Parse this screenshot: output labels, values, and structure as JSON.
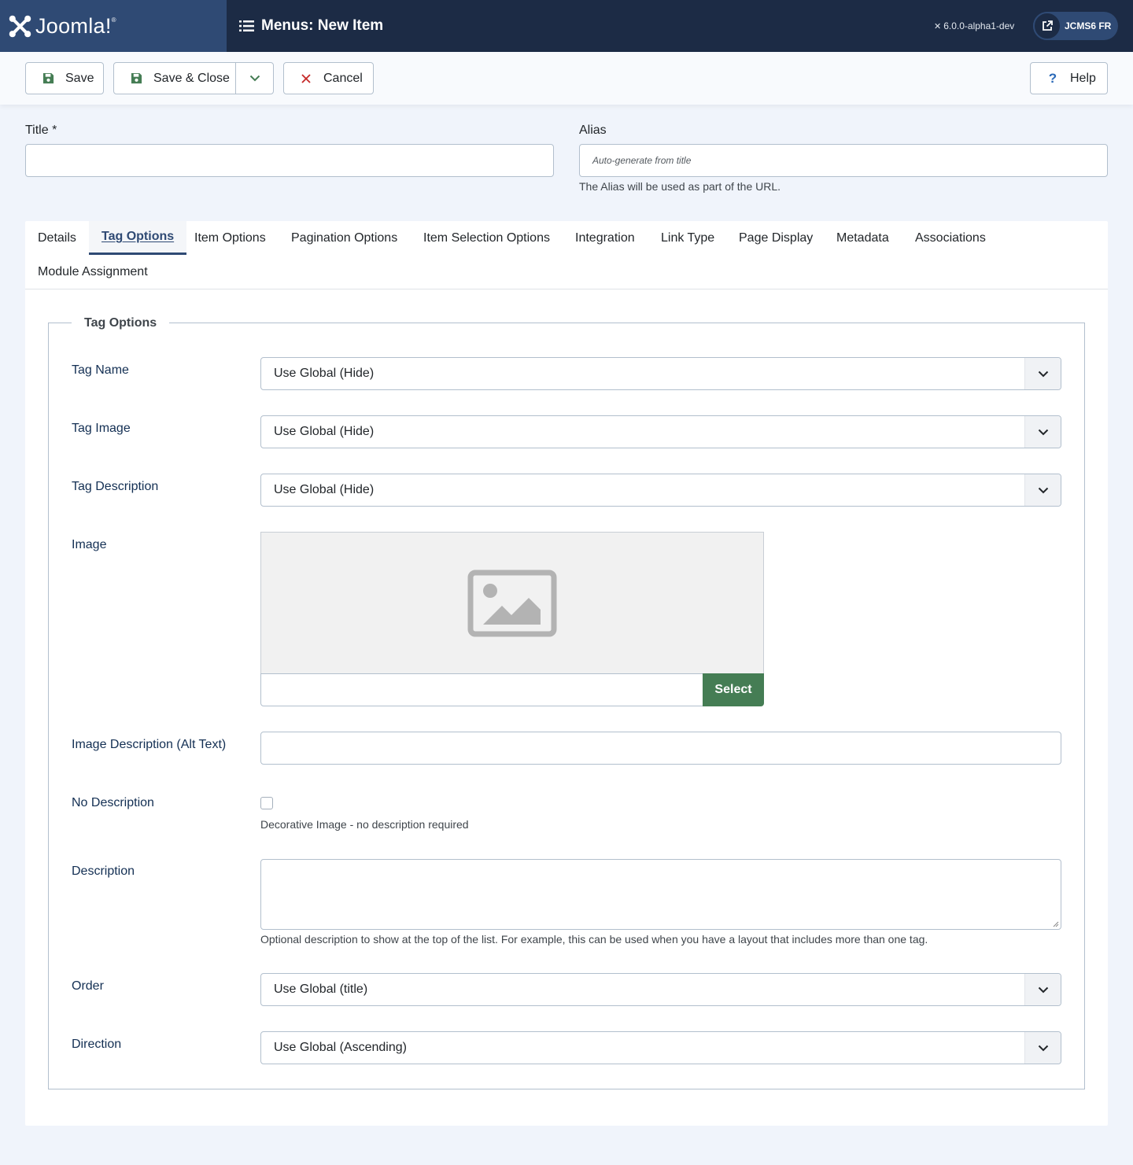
{
  "header": {
    "logo_text": "Joomla!",
    "page_title": "Menus: New Item",
    "version": "6.0.0-alpha1-dev",
    "site_label": "JCMS6 FR",
    "colors": {
      "header_bg": "#1c2b45",
      "logo_bg": "#2f4a74"
    }
  },
  "toolbar": {
    "save_label": "Save",
    "save_close_label": "Save & Close",
    "cancel_label": "Cancel",
    "help_label": "Help",
    "help_glyph": "?"
  },
  "form": {
    "title_label": "Title *",
    "title_value": "",
    "alias_label": "Alias",
    "alias_placeholder": "Auto-generate from title",
    "alias_help": "The Alias will be used as part of the URL."
  },
  "tabs": [
    {
      "label": "Details"
    },
    {
      "label": "Tag Options",
      "active": true
    },
    {
      "label": "Item Options"
    },
    {
      "label": "Pagination Options"
    },
    {
      "label": "Item Selection Options"
    },
    {
      "label": "Integration"
    },
    {
      "label": "Link Type"
    },
    {
      "label": "Page Display"
    },
    {
      "label": "Metadata"
    },
    {
      "label": "Associations"
    },
    {
      "label": "Module Assignment"
    }
  ],
  "tag_options": {
    "legend": "Tag Options",
    "tag_name": {
      "label": "Tag Name",
      "value": "Use Global (Hide)"
    },
    "tag_image": {
      "label": "Tag Image",
      "value": "Use Global (Hide)"
    },
    "tag_description": {
      "label": "Tag Description",
      "value": "Use Global (Hide)"
    },
    "image": {
      "label": "Image",
      "select_label": "Select",
      "path_value": ""
    },
    "alt_text": {
      "label": "Image Description (Alt Text)",
      "value": ""
    },
    "no_description": {
      "label": "No Description",
      "checked": false,
      "help": "Decorative Image - no description required"
    },
    "description": {
      "label": "Description",
      "value": "",
      "help": "Optional description to show at the top of the list. For example, this can be used when you have a layout that includes more than one tag."
    },
    "order": {
      "label": "Order",
      "value": "Use Global (title)"
    },
    "direction": {
      "label": "Direction",
      "value": "Use Global (Ascending)"
    }
  },
  "accent_colors": {
    "select_button": "#457d54",
    "cancel_icon": "#c52827",
    "active_tab": "#2f4a74"
  }
}
